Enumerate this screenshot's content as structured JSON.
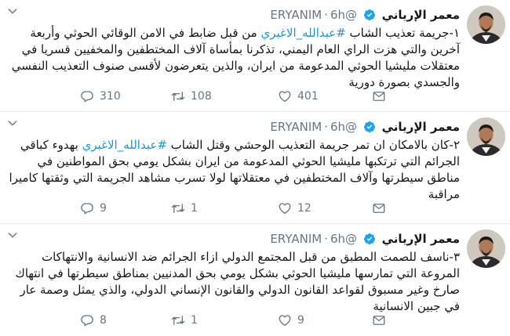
{
  "tweets": [
    {
      "name": "معمر الإرياني",
      "handle": "@ERYANIM",
      "time": "6h",
      "text_pre": "١-جريمة تعذيب الشاب ",
      "hashtag": "#عبدالله_الاغبري",
      "text_post": " من قبل ضابط في الامن الوقائي الحوثي وأربعة آخرين والتي هزت الراي العام اليمني، تذكرنا بمأساة آلاف المختطفين والمخفيين قسريا في معتقلات مليشيا الحوثي المدعومة من ايران، والذين يتعرضون لأقسى صنوف التعذيب النفسي والجسدي بصورة دورية",
      "replies": "310",
      "retweets": "108",
      "likes": "401"
    },
    {
      "name": "معمر الإرياني",
      "handle": "@ERYANIM",
      "time": "6h",
      "text_pre": "٢-كان بالامكان ان تمر جريمة التعذيب الوحشي وقتل الشاب ",
      "hashtag": "#عبدالله_الاغبري",
      "text_post": " بهدوء كباقي الجرائم التي ترتكبها مليشيا الحوثي المدعومة من ايران بشكل يومي بحق المواطنين في مناطق سيطرتها وآلاف المختطفين في معتقلاتها لولا تسرب مشاهد الجريمة التي وثقتها كاميرا مراقبة",
      "replies": "9",
      "retweets": "1",
      "likes": "12"
    },
    {
      "name": "معمر الإرياني",
      "handle": "@ERYANIM",
      "time": "6h",
      "text_pre": "٣-ناسف للصمت المطبق من قبل المجتمع الدولي ازاء الجرائم ضد الانسانية والانتهاكات المروعة التي تمارسها مليشيا الحوثي بشكل يومي بحق المدنيين بمناطق سيطرتها في انتهاك صارخ وغير مسبوق لقواعد القانون الدولي والقانون الإنساني الدولي، والذي يمثل وصمة عار في جبين الانسانية",
      "hashtag": "",
      "text_post": "",
      "replies": "8",
      "retweets": "1",
      "likes": "9"
    }
  ],
  "colors": {
    "accent": "#1b95e0",
    "secondary_text": "#657786",
    "verified": "#1da1f2"
  },
  "icons": [
    "avatar",
    "verified-badge-icon",
    "chevron-down-icon",
    "reply-icon",
    "retweet-icon",
    "like-icon",
    "direct-message-icon"
  ]
}
